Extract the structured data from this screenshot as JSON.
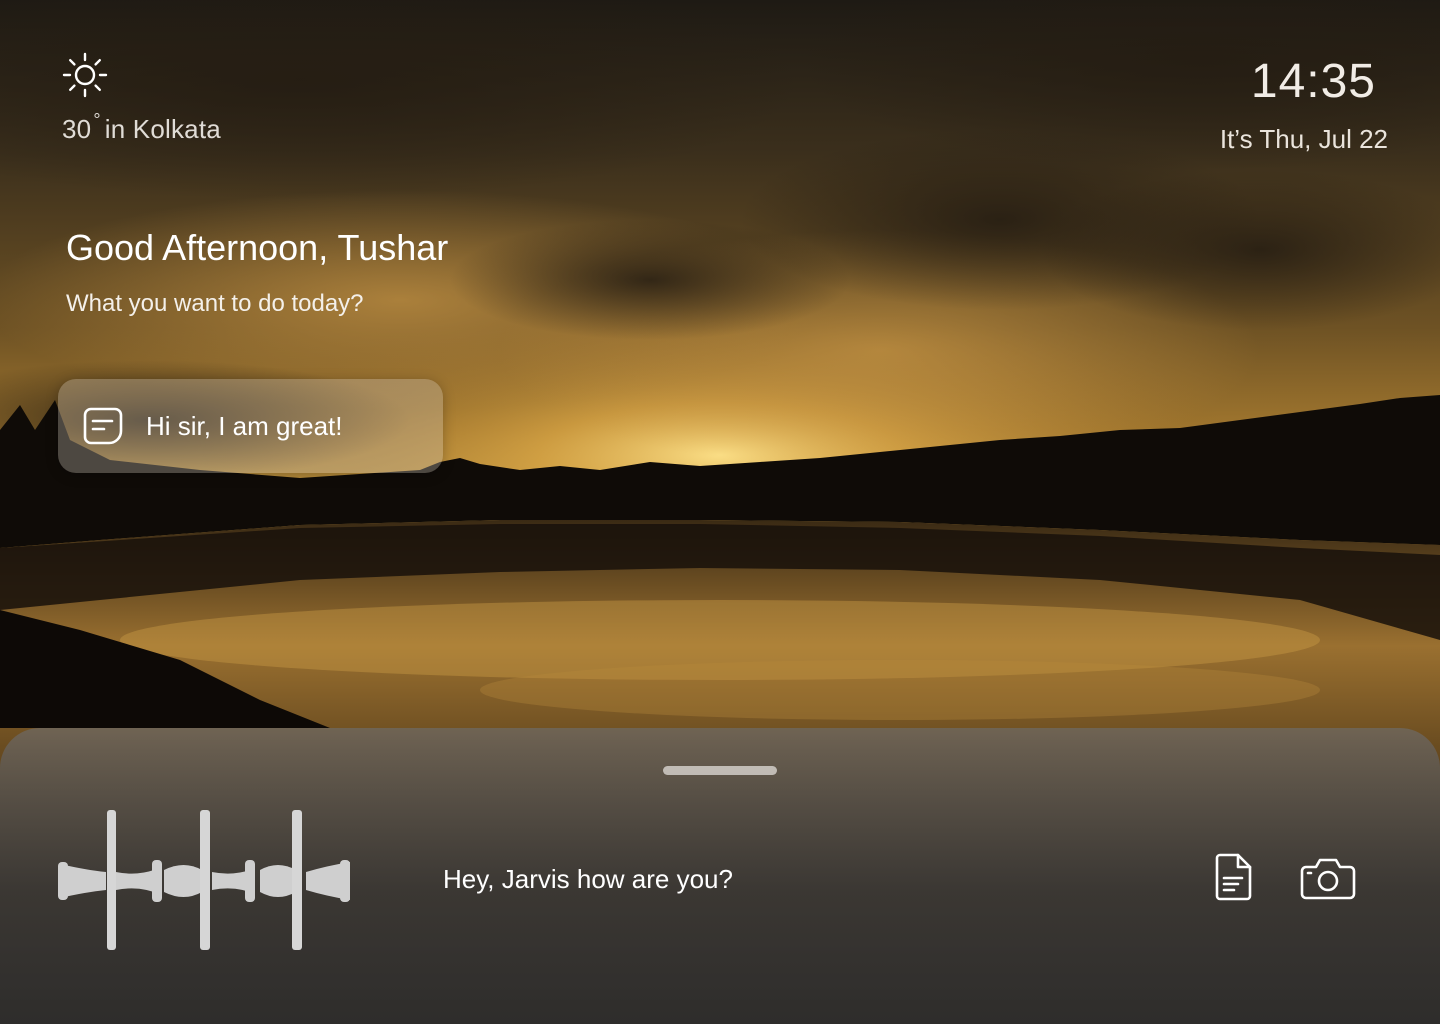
{
  "weather": {
    "icon": "sun-icon",
    "temperature": "30",
    "degree_symbol": "°",
    "location_text": "in Kolkata"
  },
  "clock": {
    "time": "14:35",
    "date": "It’s Thu, Jul 22"
  },
  "greeting": {
    "title": "Good Afternoon, Tushar",
    "subtitle": "What you want to do today?"
  },
  "assistant_response": {
    "icon": "chat-message-icon",
    "text": "Hi sir, I am great!"
  },
  "voice_panel": {
    "waveform_icon": "voice-waveform-icon",
    "query": "Hey, Jarvis how are you?",
    "actions": [
      {
        "icon": "document-icon"
      },
      {
        "icon": "camera-icon"
      }
    ]
  },
  "colors": {
    "text_primary": "#ffffff",
    "text_secondary": "#e0dcd6",
    "card_background": "#c8beb2",
    "panel_background": "#3c3a38",
    "icon_stroke": "#ffffff"
  }
}
